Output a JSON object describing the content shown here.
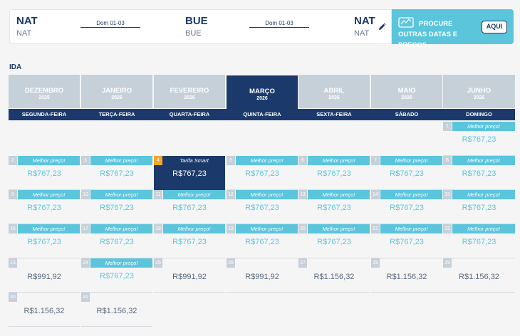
{
  "search": {
    "origin": {
      "code": "NAT",
      "name": "NAT"
    },
    "destination_mid": {
      "code": "BUE",
      "name": "BUE"
    },
    "return_city": {
      "code": "NAT",
      "name": "NAT"
    },
    "outbound_date": "Dom 01-03",
    "return_date": "Dom 01-03"
  },
  "promo": {
    "text": "PROCURE OUTRAS DATAS E PREÇOS",
    "button": "AQUI"
  },
  "section": "IDA",
  "months": [
    {
      "name": "DEZEMBRO",
      "year": "2025",
      "active": false
    },
    {
      "name": "JANEIRO",
      "year": "2026",
      "active": false
    },
    {
      "name": "FEVEREIRO",
      "year": "2026",
      "active": false
    },
    {
      "name": "MARÇO",
      "year": "2026",
      "active": true
    },
    {
      "name": "ABRIL",
      "year": "2026",
      "active": false
    },
    {
      "name": "MAIO",
      "year": "2026",
      "active": false
    },
    {
      "name": "JUNHO",
      "year": "2026",
      "active": false
    }
  ],
  "weekdays": [
    "SEGUNDA-FEIRA",
    "TERÇA-FEIRA",
    "QUARTA-FEIRA",
    "QUINTA-FEIRA",
    "SEXTA-FEIRA",
    "SÁBADO",
    "DOMINGO"
  ],
  "days": [
    {
      "day": "1",
      "label": "Melhor preço!",
      "price": "R$767,23",
      "best": true
    },
    {
      "day": "2",
      "label": "Melhor preço!",
      "price": "R$767,23",
      "best": true
    },
    {
      "day": "3",
      "label": "Melhor preço!",
      "price": "R$767,23",
      "best": true
    },
    {
      "day": "4",
      "label": "Tarifa Smart",
      "price": "R$767,23",
      "best": true,
      "selected": true
    },
    {
      "day": "5",
      "label": "Melhor preço!",
      "price": "R$767,23",
      "best": true
    },
    {
      "day": "6",
      "label": "Melhor preço!",
      "price": "R$767,23",
      "best": true
    },
    {
      "day": "7",
      "label": "Melhor preço!",
      "price": "R$767,23",
      "best": true
    },
    {
      "day": "8",
      "label": "Melhor preço!",
      "price": "R$767,23",
      "best": true
    },
    {
      "day": "9",
      "label": "Melhor preço!",
      "price": "R$767,23",
      "best": true
    },
    {
      "day": "10",
      "label": "Melhor preço!",
      "price": "R$767,23",
      "best": true
    },
    {
      "day": "11",
      "label": "Melhor preço!",
      "price": "R$767,23",
      "best": true
    },
    {
      "day": "12",
      "label": "Melhor preço!",
      "price": "R$767,23",
      "best": true
    },
    {
      "day": "13",
      "label": "Melhor preço!",
      "price": "R$767,23",
      "best": true
    },
    {
      "day": "14",
      "label": "Melhor preço!",
      "price": "R$767,23",
      "best": true
    },
    {
      "day": "15",
      "label": "Melhor preço!",
      "price": "R$767,23",
      "best": true
    },
    {
      "day": "16",
      "label": "Melhor preço!",
      "price": "R$767,23",
      "best": true
    },
    {
      "day": "17",
      "label": "Melhor preço!",
      "price": "R$767,23",
      "best": true
    },
    {
      "day": "18",
      "label": "Melhor preço!",
      "price": "R$767,23",
      "best": true
    },
    {
      "day": "19",
      "label": "Melhor preço!",
      "price": "R$767,23",
      "best": true
    },
    {
      "day": "20",
      "label": "Melhor preço!",
      "price": "R$767,23",
      "best": true
    },
    {
      "day": "21",
      "label": "Melhor preço!",
      "price": "R$767,23",
      "best": true
    },
    {
      "day": "22",
      "label": "Melhor preço!",
      "price": "R$767,23",
      "best": true
    },
    {
      "day": "23",
      "label": "",
      "price": "R$991,92",
      "best": false
    },
    {
      "day": "24",
      "label": "Melhor preço!",
      "price": "R$767,23",
      "best": true
    },
    {
      "day": "25",
      "label": "",
      "price": "R$991,92",
      "best": false
    },
    {
      "day": "26",
      "label": "",
      "price": "R$991,92",
      "best": false
    },
    {
      "day": "27",
      "label": "",
      "price": "R$1.156,32",
      "best": false
    },
    {
      "day": "28",
      "label": "",
      "price": "R$1.156,32",
      "best": false
    },
    {
      "day": "29",
      "label": "",
      "price": "R$1.156,32",
      "best": false
    },
    {
      "day": "30",
      "label": "",
      "price": "R$1.156,32",
      "best": false
    },
    {
      "day": "31",
      "label": "",
      "price": "R$1.156,32",
      "best": false
    }
  ],
  "colors": {
    "navy": "#1b3a6b",
    "accent": "#5bc5dc",
    "muted": "#c6d0d9",
    "highlight": "#f5a623"
  }
}
